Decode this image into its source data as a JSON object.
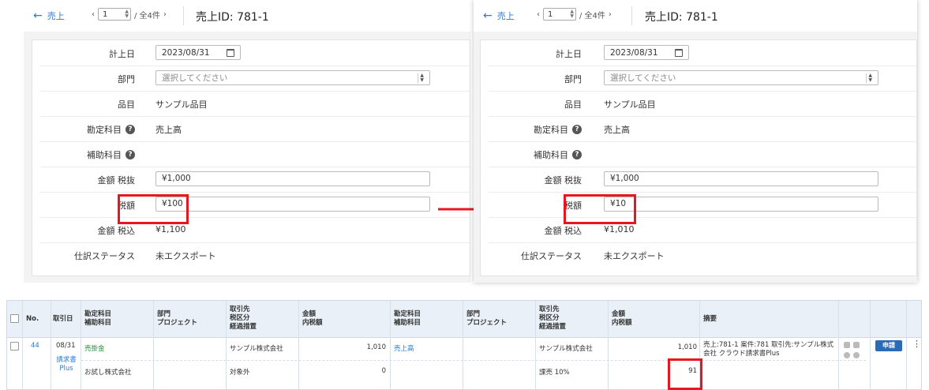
{
  "panels": [
    {
      "back_label": "売上",
      "page_num": "1",
      "page_total": "/ 全4件",
      "title": "売上ID: 781-1",
      "fields": {
        "date_label": "計上日",
        "date_value": "2023/08/31",
        "dept_label": "部門",
        "dept_placeholder": "選択してください",
        "item_label": "品目",
        "item_value": "サンプル品目",
        "account_label": "勘定科目",
        "account_value": "売上高",
        "sub_account_label": "補助科目",
        "amount_excl_label": "金額 税抜",
        "amount_excl_value": "¥1,000",
        "tax_label": "税額",
        "tax_value": "¥100",
        "amount_incl_label": "金額 税込",
        "amount_incl_value": "¥1,100",
        "status_label": "仕訳ステータス",
        "status_value": "未エクスポート"
      }
    },
    {
      "back_label": "売上",
      "page_num": "1",
      "page_total": "/ 全4件",
      "title": "売上ID: 781-1",
      "fields": {
        "date_label": "計上日",
        "date_value": "2023/08/31",
        "dept_label": "部門",
        "dept_placeholder": "選択してください",
        "item_label": "品目",
        "item_value": "サンプル品目",
        "account_label": "勘定科目",
        "account_value": "売上高",
        "sub_account_label": "補助科目",
        "amount_excl_label": "金額 税抜",
        "amount_excl_value": "¥1,000",
        "tax_label": "税額",
        "tax_value": "¥10",
        "amount_incl_label": "金額 税込",
        "amount_incl_value": "¥1,010",
        "status_label": "仕訳ステータス",
        "status_value": "未エクスポート"
      }
    }
  ],
  "ledger": {
    "headers": {
      "no": "No.",
      "date": "取引日",
      "debit_account": "勘定科目\n補助科目",
      "debit_dept": "部門\nプロジェクト",
      "debit_partner": "取引先\n税区分\n経過措置",
      "debit_amount": "金額\n内税額",
      "credit_account": "勘定科目\n補助科目",
      "credit_dept": "部門\nプロジェクト",
      "credit_partner": "取引先\n税区分\n経過措置",
      "credit_amount": "金額\n内税額",
      "memo": "摘要"
    },
    "row": {
      "no": "44",
      "date": "08/31",
      "source": "請求書\nPlus",
      "debit_account": "売掛金",
      "debit_sub": "お試し株式会社",
      "debit_partner": "サンプル株式会社",
      "debit_tax_class": "対象外",
      "debit_amount": "1,010",
      "debit_tax": "0",
      "credit_account": "売上高",
      "credit_partner": "サンプル株式会社",
      "credit_tax_class": "課売 10%",
      "credit_amount": "1,010",
      "credit_tax": "91",
      "memo": "売上:781-1 案件:781 取引先:サンプル株式会社 クラウド請求書Plus",
      "apply_label": "申請"
    }
  }
}
